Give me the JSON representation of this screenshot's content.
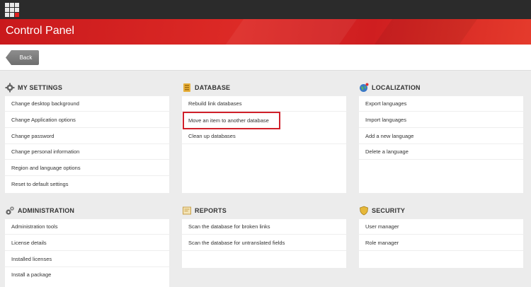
{
  "header": {
    "title": "Control Panel"
  },
  "toolbar": {
    "back_label": "Back"
  },
  "sections": {
    "my_settings": {
      "title": "MY SETTINGS",
      "items": [
        "Change desktop background",
        "Change Application options",
        "Change password",
        "Change personal information",
        "Region and language options",
        "Reset to default settings"
      ]
    },
    "database": {
      "title": "DATABASE",
      "items": [
        "Rebuild link databases",
        "Move an item to another database",
        "Clean up databases"
      ]
    },
    "localization": {
      "title": "LOCALIZATION",
      "items": [
        "Export languages",
        "Import languages",
        "Add a new language",
        "Delete a language"
      ]
    },
    "administration": {
      "title": "ADMINISTRATION",
      "items": [
        "Administration tools",
        "License details",
        "Installed licenses",
        "Install a package"
      ]
    },
    "reports": {
      "title": "REPORTS",
      "items": [
        "Scan the database for broken links",
        "Scan the database for untranslated fields"
      ]
    },
    "security": {
      "title": "SECURITY",
      "items": [
        "User manager",
        "Role manager"
      ]
    }
  },
  "icons": {
    "my_settings": "gear-icon",
    "database": "database-icon",
    "localization": "globe-icon",
    "administration": "gears-icon",
    "reports": "report-icon",
    "security": "shield-icon"
  },
  "colors": {
    "brand_red": "#d8262a",
    "topbar": "#2b2b2b",
    "highlight": "#d0202a"
  }
}
